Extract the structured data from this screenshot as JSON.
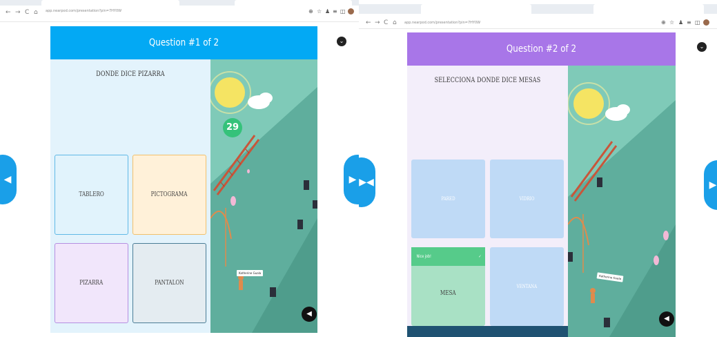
{
  "left": {
    "browser": {
      "nav": [
        "←",
        "→",
        "C",
        "⌂"
      ],
      "url": "app.nearpod.com/presentation?pin=7HY0W",
      "ext_icons": [
        "⊕",
        "☆",
        "♟",
        "≡",
        "◫"
      ]
    },
    "header": {
      "title": "Question #1 of 2",
      "color": "#03a9f4"
    },
    "question": {
      "text": "DONDE DICE PIZARRA"
    },
    "options": [
      {
        "label": "TABLERO",
        "bg": "#e1f3fc",
        "border": "#5fb8e6"
      },
      {
        "label": "PICTOGRAMA",
        "bg": "#fff1d9",
        "border": "#f2c06b"
      },
      {
        "label": "PIZARRA",
        "bg": "#f1e6fb",
        "border": "#b58ee0"
      },
      {
        "label": "PANTALON",
        "bg": "#e4ecf1",
        "border": "#4a7c96"
      }
    ],
    "timer": "29",
    "student_name": "Katherine Guala",
    "icons": {
      "collapse": "chevron-down-icon",
      "prev": "chevron-left-icon",
      "sound": "speaker-icon"
    }
  },
  "right": {
    "browser": {
      "nav": [
        "←",
        "→",
        "C",
        "⌂"
      ],
      "url": "app.nearpod.com/presentation?pin=7HY0W",
      "ext_icons": [
        "⊕",
        "☆",
        "♟",
        "≡",
        "◫"
      ]
    },
    "header": {
      "title": "Question #2 of 2",
      "color": "#a876e8"
    },
    "question": {
      "text": "SELECCIONA DONDE DICE MESAS"
    },
    "options": [
      {
        "label": "PARED",
        "bg": "#bfdaf6",
        "border": "#bfdaf6"
      },
      {
        "label": "VIDRIO",
        "bg": "#bfdaf6",
        "border": "#bfdaf6"
      },
      {
        "label": "MESA",
        "bg": "#a9e1c5",
        "border": "#a9e1c5"
      },
      {
        "label": "VENTANA",
        "bg": "#bfdaf6",
        "border": "#bfdaf6"
      }
    ],
    "selected_banner": {
      "label": "Nice job!",
      "check": "✓"
    },
    "student_name": "Katherine Guala",
    "icons": {
      "collapse": "chevron-down-icon",
      "next": "chevron-right-icon",
      "sound": "speaker-icon"
    }
  }
}
